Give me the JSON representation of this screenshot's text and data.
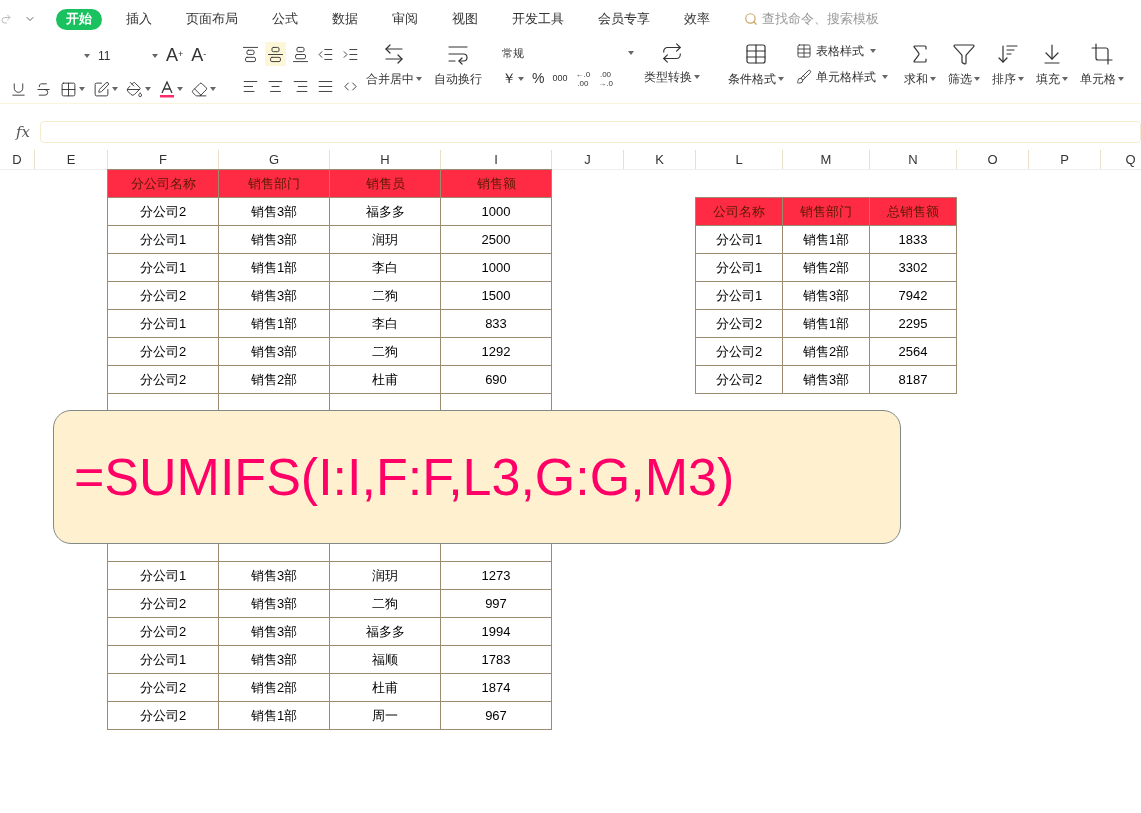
{
  "menu_tabs": [
    {
      "label": "开始",
      "selected": true
    },
    {
      "label": "插入",
      "selected": false
    },
    {
      "label": "页面布局",
      "selected": false
    },
    {
      "label": "公式",
      "selected": false
    },
    {
      "label": "数据",
      "selected": false
    },
    {
      "label": "审阅",
      "selected": false
    },
    {
      "label": "视图",
      "selected": false
    },
    {
      "label": "开发工具",
      "selected": false
    },
    {
      "label": "会员专享",
      "selected": false
    },
    {
      "label": "效率",
      "selected": false
    }
  ],
  "search": {
    "placeholder": "查找命令、搜索模板"
  },
  "font_size": "11",
  "font_increase": {
    "letter": "A",
    "sign": "+"
  },
  "font_decrease": {
    "letter": "A",
    "sign": "-"
  },
  "merge_center": "合并居中",
  "wrap_text": "自动换行",
  "number_format": "常规",
  "number_buttons": {
    "currency": "￥",
    "percent": "%",
    "thousands": "000",
    "increase_decimal": [
      "←.0",
      ".00"
    ],
    "decrease_decimal": [
      ".00",
      "→.0"
    ]
  },
  "type_convert": "类型转换",
  "conditional_format": "条件格式",
  "table_style": "表格样式",
  "cell_style": "单元格样式",
  "big_tools": [
    "求和",
    "筛选",
    "排序",
    "填充",
    "单元格"
  ],
  "formula_bar": {
    "fx": "fx"
  },
  "columns": [
    "D",
    "E",
    "F",
    "G",
    "H",
    "I",
    "J",
    "K",
    "L",
    "M",
    "N",
    "O",
    "P",
    "Q"
  ],
  "sales_table": {
    "headers": [
      "分公司名称",
      "销售部门",
      "销售员",
      "销售额"
    ],
    "rows_above": [
      [
        "分公司2",
        "销售3部",
        "福多多",
        "1000"
      ],
      [
        "分公司1",
        "销售3部",
        "润玥",
        "2500"
      ],
      [
        "分公司1",
        "销售1部",
        "李白",
        "1000"
      ],
      [
        "分公司2",
        "销售3部",
        "二狗",
        "1500"
      ],
      [
        "分公司1",
        "销售1部",
        "李白",
        "833"
      ],
      [
        "分公司2",
        "销售3部",
        "二狗",
        "1292"
      ],
      [
        "分公司2",
        "销售2部",
        "杜甫",
        "690"
      ]
    ],
    "rows_below": [
      [
        "分公司1",
        "销售3部",
        "润玥",
        "1273"
      ],
      [
        "分公司2",
        "销售3部",
        "二狗",
        "997"
      ],
      [
        "分公司2",
        "销售3部",
        "福多多",
        "1994"
      ],
      [
        "分公司1",
        "销售3部",
        "福顺",
        "1783"
      ],
      [
        "分公司2",
        "销售2部",
        "杜甫",
        "1874"
      ],
      [
        "分公司2",
        "销售1部",
        "周一",
        "967"
      ]
    ]
  },
  "summary_table": {
    "headers": [
      "公司名称",
      "销售部门",
      "总销售额"
    ],
    "rows": [
      [
        "分公司1",
        "销售1部",
        "1833"
      ],
      [
        "分公司1",
        "销售2部",
        "3302"
      ],
      [
        "分公司1",
        "销售3部",
        "7942"
      ],
      [
        "分公司2",
        "销售1部",
        "2295"
      ],
      [
        "分公司2",
        "销售2部",
        "2564"
      ],
      [
        "分公司2",
        "销售3部",
        "8187"
      ]
    ]
  },
  "formula_callout": "=SUMIFS(I:I,F:F,L3,G:G,M3)"
}
